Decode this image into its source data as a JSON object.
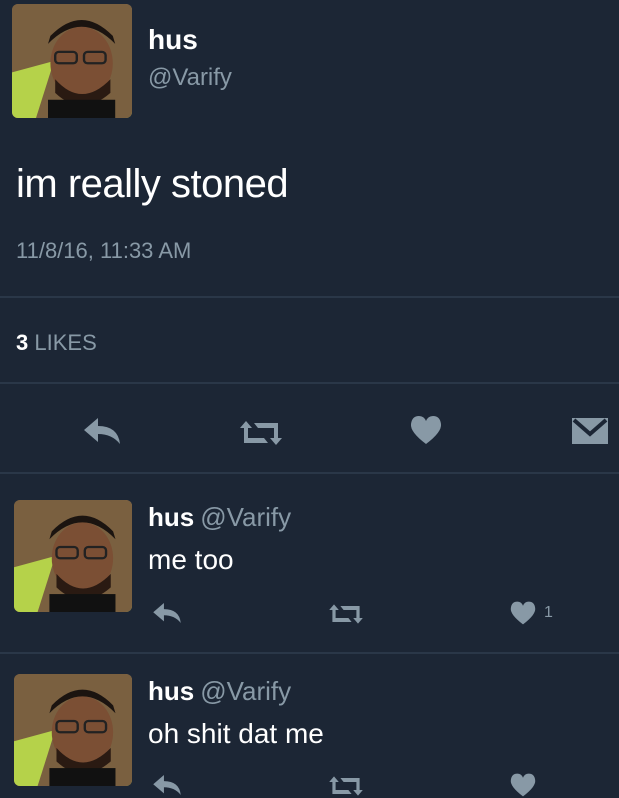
{
  "tweet": {
    "name": "hus",
    "handle": "@Varify",
    "text": "im really stoned",
    "timestamp": "11/8/16, 11:33 AM",
    "likes_count": "3",
    "likes_label": "LIKES"
  },
  "replies": [
    {
      "name": "hus",
      "handle": "@Varify",
      "text": "me too",
      "like_count": "1"
    },
    {
      "name": "hus",
      "handle": "@Varify",
      "text": "oh shit dat me",
      "like_count": ""
    }
  ],
  "icons": {
    "reply": "reply-icon",
    "retweet": "retweet-icon",
    "like": "heart-icon",
    "message": "envelope-icon"
  },
  "colors": {
    "background": "#1c2635",
    "secondary_text": "#8899a6",
    "primary_text": "#ffffff"
  }
}
